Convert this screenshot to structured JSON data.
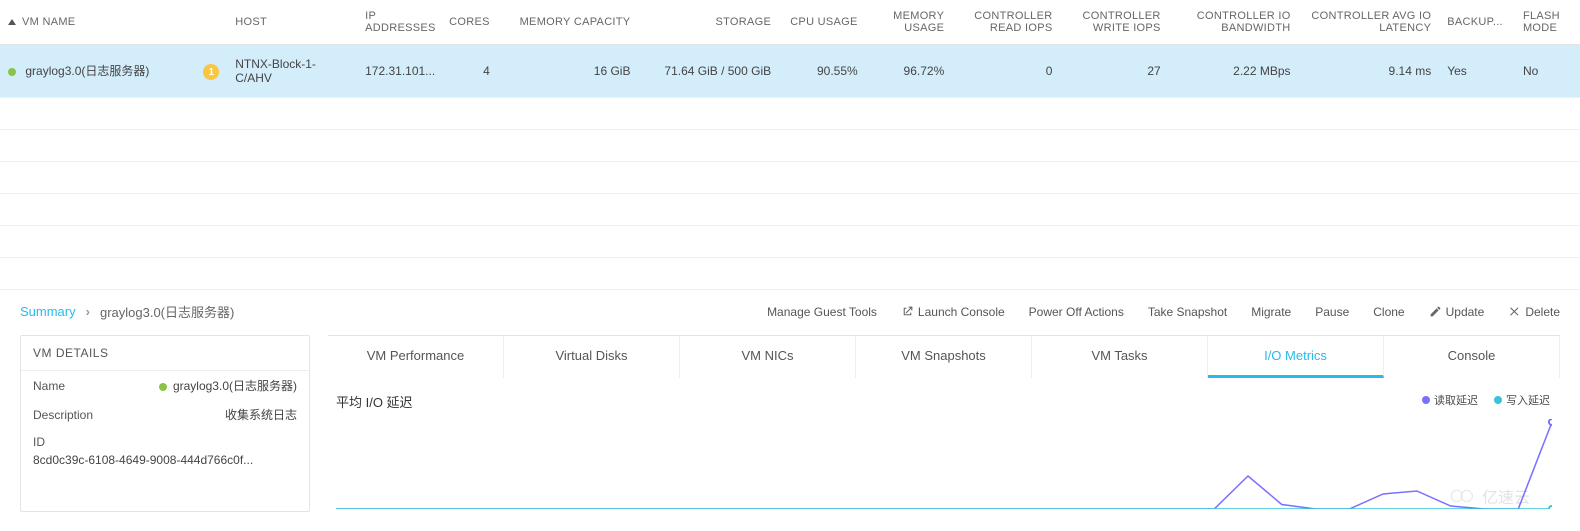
{
  "table": {
    "columns": [
      {
        "key": "vm_name",
        "label": "VM NAME",
        "align": "left",
        "sort": "asc"
      },
      {
        "key": "host",
        "label": "HOST",
        "align": "left"
      },
      {
        "key": "ip",
        "label": "IP ADDRESSES",
        "align": "left"
      },
      {
        "key": "cores",
        "label": "CORES",
        "align": "right"
      },
      {
        "key": "memory",
        "label": "MEMORY CAPACITY",
        "align": "right"
      },
      {
        "key": "storage",
        "label": "STORAGE",
        "align": "right"
      },
      {
        "key": "cpu_usage",
        "label": "CPU USAGE",
        "align": "right"
      },
      {
        "key": "mem_usage",
        "label": "MEMORY USAGE",
        "align": "right"
      },
      {
        "key": "read_iops",
        "label": "CONTROLLER READ IOPS",
        "align": "right"
      },
      {
        "key": "write_iops",
        "label": "CONTROLLER WRITE IOPS",
        "align": "right"
      },
      {
        "key": "io_bw",
        "label": "CONTROLLER IO BANDWIDTH",
        "align": "right"
      },
      {
        "key": "io_lat",
        "label": "CONTROLLER AVG IO LATENCY",
        "align": "right"
      },
      {
        "key": "backup",
        "label": "BACKUP...",
        "align": "left"
      },
      {
        "key": "flash",
        "label": "FLASH MODE",
        "align": "left"
      }
    ],
    "row": {
      "vm_name": "graylog3.0(日志服务器)",
      "alert_count": "1",
      "host": "NTNX-Block-1-C/AHV",
      "ip": "172.31.101...",
      "cores": "4",
      "memory": "16 GiB",
      "storage": "71.64 GiB / 500 GiB",
      "cpu_usage": "90.55%",
      "mem_usage": "96.72%",
      "read_iops": "0",
      "write_iops": "27",
      "io_bw": "2.22 MBps",
      "io_lat": "9.14 ms",
      "backup": "Yes",
      "flash": "No"
    }
  },
  "breadcrumb": {
    "root": "Summary",
    "current": "graylog3.0(日志服务器)"
  },
  "actions": {
    "manage_guest_tools": "Manage Guest Tools",
    "launch_console": "Launch Console",
    "power_off": "Power Off Actions",
    "take_snapshot": "Take Snapshot",
    "migrate": "Migrate",
    "pause": "Pause",
    "clone": "Clone",
    "update": "Update",
    "delete": "Delete"
  },
  "details_panel": {
    "title": "VM DETAILS",
    "name_label": "Name",
    "name_value": "graylog3.0(日志服务器)",
    "description_label": "Description",
    "description_value": "收集系统日志",
    "id_label": "ID",
    "id_value": "8cd0c39c-6108-4649-9008-444d766c0f..."
  },
  "tabs": {
    "perf": "VM Performance",
    "disks": "Virtual Disks",
    "nics": "VM NICs",
    "snaps": "VM Snapshots",
    "tasks": "VM Tasks",
    "io": "I/O Metrics",
    "console": "Console"
  },
  "chart_data": {
    "type": "line",
    "title": "平均 I/O 延迟",
    "xlabel": "",
    "ylabel": "",
    "series": [
      {
        "name": "读取延迟",
        "color": "#7b6fff",
        "values": [
          0,
          0,
          0,
          0,
          0,
          0,
          0,
          0,
          0,
          0,
          0,
          0,
          0,
          0,
          0,
          0,
          0,
          0,
          0,
          0,
          0,
          0,
          0,
          0,
          0,
          0,
          0,
          22,
          3,
          0,
          0,
          10,
          12,
          2,
          0,
          0,
          58
        ]
      },
      {
        "name": "写入延迟",
        "color": "#34c6d8",
        "values": [
          0,
          0,
          0,
          0,
          0,
          0,
          0,
          0,
          0,
          0,
          0,
          0,
          0,
          0,
          0,
          0,
          0,
          0,
          0,
          0,
          0,
          0,
          0,
          0,
          0,
          0,
          0,
          0,
          0,
          0,
          0,
          0,
          0,
          0,
          0,
          0,
          0
        ]
      }
    ],
    "ylim": [
      0,
      60
    ]
  },
  "watermark": "亿速云",
  "colors": {
    "accent": "#27bbec",
    "status_green": "#8bc34a"
  }
}
